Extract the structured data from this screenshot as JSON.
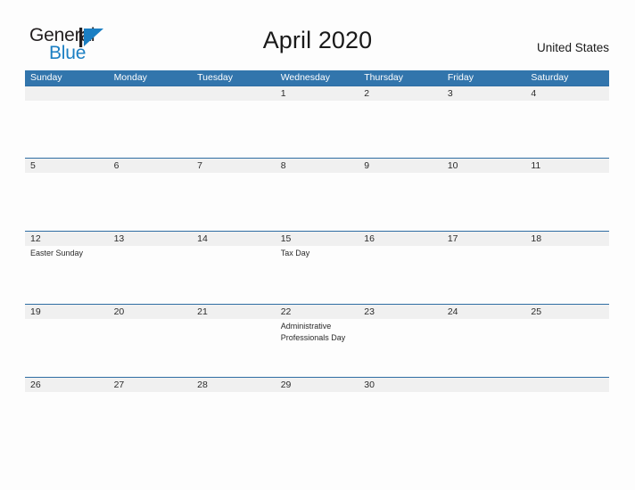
{
  "brand": {
    "name_part1": "General",
    "name_part2": "Blue",
    "mark_color": "#1b7fc3"
  },
  "header": {
    "title": "April 2020",
    "region": "United States"
  },
  "theme": {
    "header_bar_color": "#3275ac",
    "row_divider_color": "#2f6da3",
    "date_strip_color": "#f0f0f0",
    "page_background": "#fdfdfd"
  },
  "calendar": {
    "weekdays": [
      "Sunday",
      "Monday",
      "Tuesday",
      "Wednesday",
      "Thursday",
      "Friday",
      "Saturday"
    ],
    "weeks": [
      {
        "days": [
          {
            "date": "",
            "event": ""
          },
          {
            "date": "",
            "event": ""
          },
          {
            "date": "",
            "event": ""
          },
          {
            "date": "1",
            "event": ""
          },
          {
            "date": "2",
            "event": ""
          },
          {
            "date": "3",
            "event": ""
          },
          {
            "date": "4",
            "event": ""
          }
        ]
      },
      {
        "days": [
          {
            "date": "5",
            "event": ""
          },
          {
            "date": "6",
            "event": ""
          },
          {
            "date": "7",
            "event": ""
          },
          {
            "date": "8",
            "event": ""
          },
          {
            "date": "9",
            "event": ""
          },
          {
            "date": "10",
            "event": ""
          },
          {
            "date": "11",
            "event": ""
          }
        ]
      },
      {
        "days": [
          {
            "date": "12",
            "event": "Easter Sunday"
          },
          {
            "date": "13",
            "event": ""
          },
          {
            "date": "14",
            "event": ""
          },
          {
            "date": "15",
            "event": "Tax Day"
          },
          {
            "date": "16",
            "event": ""
          },
          {
            "date": "17",
            "event": ""
          },
          {
            "date": "18",
            "event": ""
          }
        ]
      },
      {
        "days": [
          {
            "date": "19",
            "event": ""
          },
          {
            "date": "20",
            "event": ""
          },
          {
            "date": "21",
            "event": ""
          },
          {
            "date": "22",
            "event": "Administrative Professionals Day"
          },
          {
            "date": "23",
            "event": ""
          },
          {
            "date": "24",
            "event": ""
          },
          {
            "date": "25",
            "event": ""
          }
        ]
      },
      {
        "days": [
          {
            "date": "26",
            "event": ""
          },
          {
            "date": "27",
            "event": ""
          },
          {
            "date": "28",
            "event": ""
          },
          {
            "date": "29",
            "event": ""
          },
          {
            "date": "30",
            "event": ""
          },
          {
            "date": "",
            "event": ""
          },
          {
            "date": "",
            "event": ""
          }
        ]
      }
    ]
  }
}
